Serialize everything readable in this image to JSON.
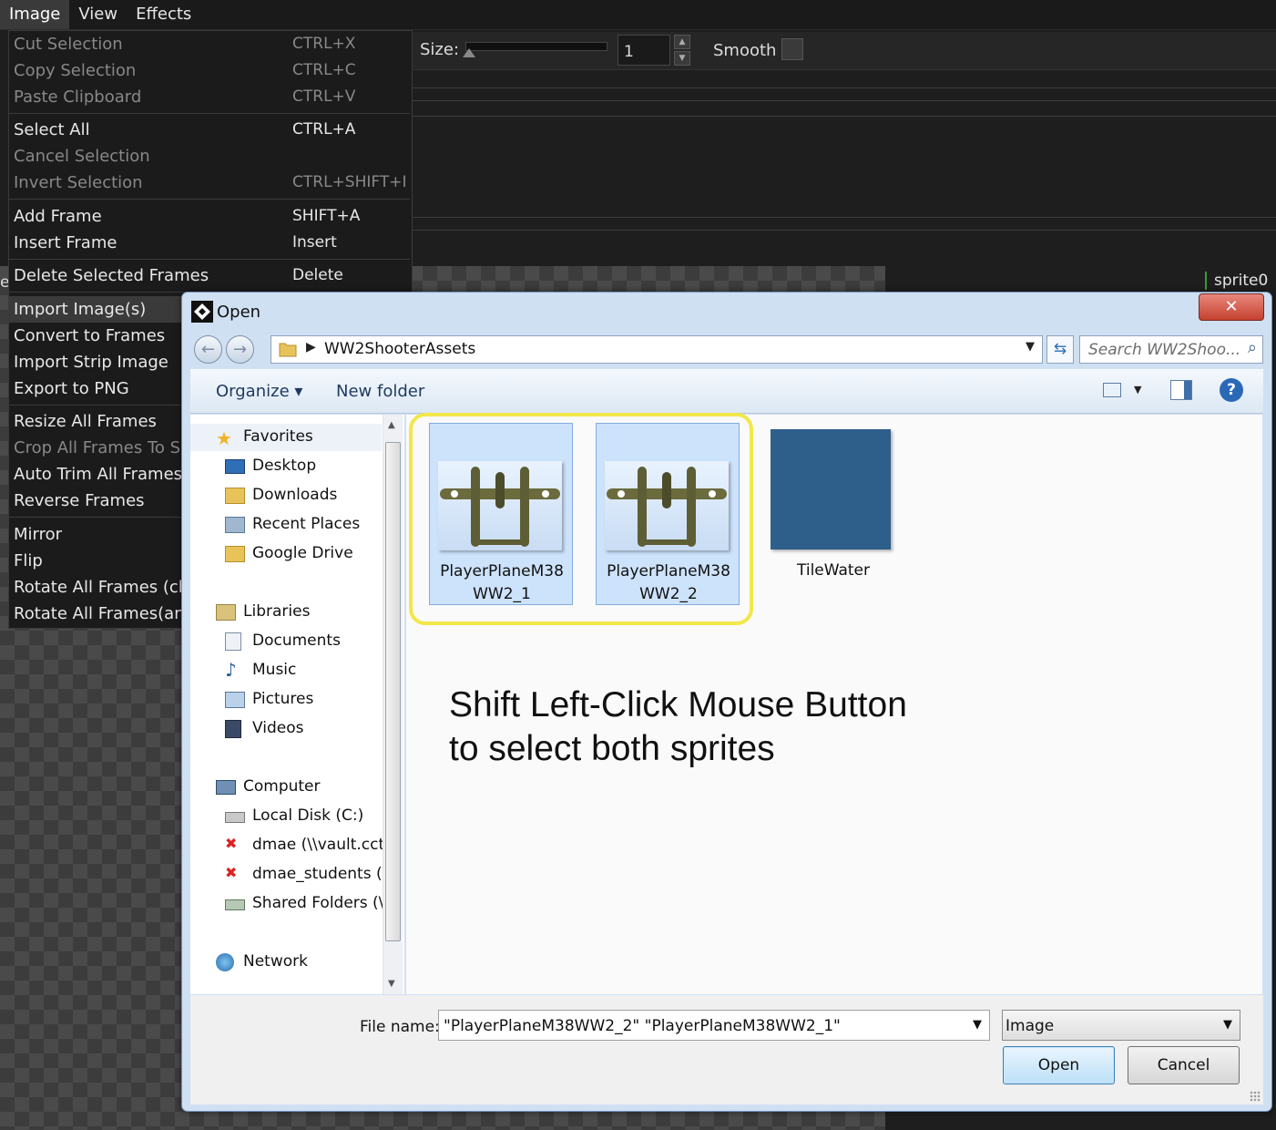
{
  "menubar": {
    "items": [
      "Image",
      "View",
      "Effects"
    ]
  },
  "toolbar": {
    "size_label": "Size:",
    "size_value": "1",
    "smooth_label": "Smooth"
  },
  "sprite_label": "sprite0",
  "edge_letter": "e",
  "image_menu": {
    "items": [
      {
        "label": "Cut Selection",
        "shortcut": "CTRL+X",
        "disabled": true
      },
      {
        "label": "Copy Selection",
        "shortcut": "CTRL+C",
        "disabled": true
      },
      {
        "label": "Paste Clipboard",
        "shortcut": "CTRL+V",
        "disabled": true
      },
      {
        "label": "Select All",
        "shortcut": "CTRL+A",
        "disabled": false
      },
      {
        "label": "Cancel Selection",
        "shortcut": "",
        "disabled": true
      },
      {
        "label": "Invert Selection",
        "shortcut": "CTRL+SHIFT+I",
        "disabled": true
      },
      {
        "label": "Add Frame",
        "shortcut": "SHIFT+A",
        "disabled": false
      },
      {
        "label": "Insert Frame",
        "shortcut": "Insert",
        "disabled": false
      },
      {
        "label": "Delete Selected Frames",
        "shortcut": "Delete",
        "disabled": false
      },
      {
        "label": "Import Image(s)",
        "shortcut": "",
        "disabled": false
      },
      {
        "label": "Convert to Frames",
        "shortcut": "",
        "disabled": false
      },
      {
        "label": "Import Strip Image",
        "shortcut": "",
        "disabled": false
      },
      {
        "label": "Export to PNG",
        "shortcut": "",
        "disabled": false
      },
      {
        "label": "Resize All Frames",
        "shortcut": "",
        "disabled": false
      },
      {
        "label": "Crop All Frames To Se",
        "shortcut": "",
        "disabled": true
      },
      {
        "label": "Auto Trim All Frames",
        "shortcut": "",
        "disabled": false
      },
      {
        "label": "Reverse Frames",
        "shortcut": "",
        "disabled": false
      },
      {
        "label": "Mirror",
        "shortcut": "",
        "disabled": false
      },
      {
        "label": "Flip",
        "shortcut": "",
        "disabled": false
      },
      {
        "label": "Rotate All Frames (clo",
        "shortcut": "",
        "disabled": false
      },
      {
        "label": "Rotate All Frames(anti",
        "shortcut": "",
        "disabled": false
      }
    ]
  },
  "dialog": {
    "title": "Open",
    "close_symbol": "✕",
    "address": "WW2ShooterAssets",
    "search_placeholder": "Search WW2Shoo...",
    "organize": "Organize",
    "new_folder": "New folder",
    "nav": {
      "favorites_header": "Favorites",
      "favorites": [
        "Desktop",
        "Downloads",
        "Recent Places",
        "Google Drive"
      ],
      "libraries_header": "Libraries",
      "libraries": [
        "Documents",
        "Music",
        "Pictures",
        "Videos"
      ],
      "computer_header": "Computer",
      "computer": [
        "Local Disk (C:)",
        "dmae (\\\\vault.cct.l",
        "dmae_students (\\\\",
        "Shared Folders (\\\\"
      ],
      "network_header": "Network"
    },
    "files": [
      {
        "name_line1": "PlayerPlaneM38",
        "name_line2": "WW2_1",
        "selected": true
      },
      {
        "name_line1": "PlayerPlaneM38",
        "name_line2": "WW2_2",
        "selected": true
      },
      {
        "name_line1": "TileWater",
        "name_line2": "",
        "selected": false
      }
    ],
    "file_name_label": "File name:",
    "file_name_value": "\"PlayerPlaneM38WW2_2\" \"PlayerPlaneM38WW2_1\"",
    "file_type": "Image",
    "open_button": "Open",
    "cancel_button": "Cancel"
  },
  "annotation": {
    "line1": "Shift Left-Click Mouse Button",
    "line2": "to select both sprites",
    "highlight_color": "#f1e74a"
  }
}
